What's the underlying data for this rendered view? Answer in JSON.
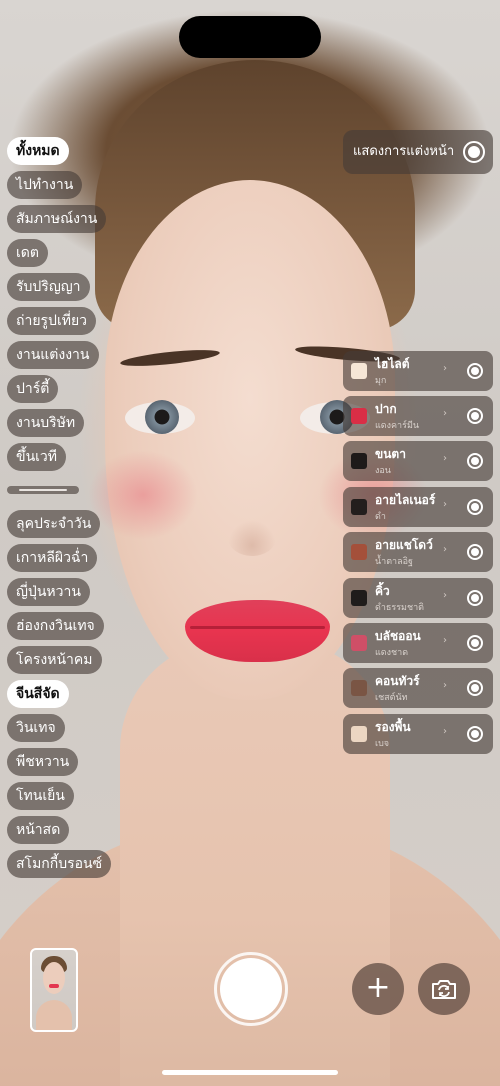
{
  "categories_top": [
    {
      "label": "ทั้งหมด",
      "active": true
    },
    {
      "label": "ไปทำงาน",
      "active": false
    },
    {
      "label": "สัมภาษณ์งาน",
      "active": false
    },
    {
      "label": "เดต",
      "active": false
    },
    {
      "label": "รับปริญญา",
      "active": false
    },
    {
      "label": "ถ่ายรูปเที่ยว",
      "active": false
    },
    {
      "label": "งานแต่งงาน",
      "active": false
    },
    {
      "label": "ปาร์ตี้",
      "active": false
    },
    {
      "label": "งานบริษัท",
      "active": false
    },
    {
      "label": "ขึ้นเวที",
      "active": false
    }
  ],
  "categories_style": [
    {
      "label": "ลุคประจำวัน",
      "active": false
    },
    {
      "label": "เกาหลีผิวฉ่ำ",
      "active": false
    },
    {
      "label": "ญี่ปุ่นหวาน",
      "active": false
    },
    {
      "label": "ฮ่องกงวินเทจ",
      "active": false
    },
    {
      "label": "โครงหน้าคม",
      "active": false
    },
    {
      "label": "จีนสีจัด",
      "active": true
    },
    {
      "label": "วินเทจ",
      "active": false
    },
    {
      "label": "พีชหวาน",
      "active": false
    },
    {
      "label": "โทนเย็น",
      "active": false
    },
    {
      "label": "หน้าสด",
      "active": false
    },
    {
      "label": "สโมกกี้บรอนซ์",
      "active": false
    }
  ],
  "makeup_toggle": {
    "label": "แสดงการแต่งหน้า",
    "on": true
  },
  "makeup_items": [
    {
      "title": "ไฮไลต์",
      "shade": "มุก",
      "color": "#f6e6d6",
      "chevron": "›",
      "on": true
    },
    {
      "title": "ปาก",
      "shade": "แดงคาร์มีน",
      "color": "#d92e46",
      "chevron": "›",
      "on": true
    },
    {
      "title": "ขนตา",
      "shade": "งอน",
      "color": "#1e1a19",
      "chevron": "›",
      "on": true
    },
    {
      "title": "อายไลเนอร์",
      "shade": "ดำ",
      "color": "#231e1d",
      "chevron": "›",
      "on": true
    },
    {
      "title": "อายแชโดว์",
      "shade": "น้ำตาลอิฐ",
      "color": "#a4503a",
      "chevron": "›",
      "on": true
    },
    {
      "title": "คิ้ว",
      "shade": "ดำธรรมชาติ",
      "color": "#1f1c1b",
      "chevron": "›",
      "on": true
    },
    {
      "title": "บลัชออน",
      "shade": "แดงชาด",
      "color": "#cf4f67",
      "chevron": "›",
      "on": true
    },
    {
      "title": "คอนทัวร์",
      "shade": "เชสต์นัท",
      "color": "#7a5544",
      "chevron": "›",
      "on": true
    },
    {
      "title": "รองพื้น",
      "shade": "เบจ",
      "color": "#ecd6c2",
      "chevron": "›",
      "on": true
    }
  ],
  "controls": {
    "add_label": "+"
  }
}
